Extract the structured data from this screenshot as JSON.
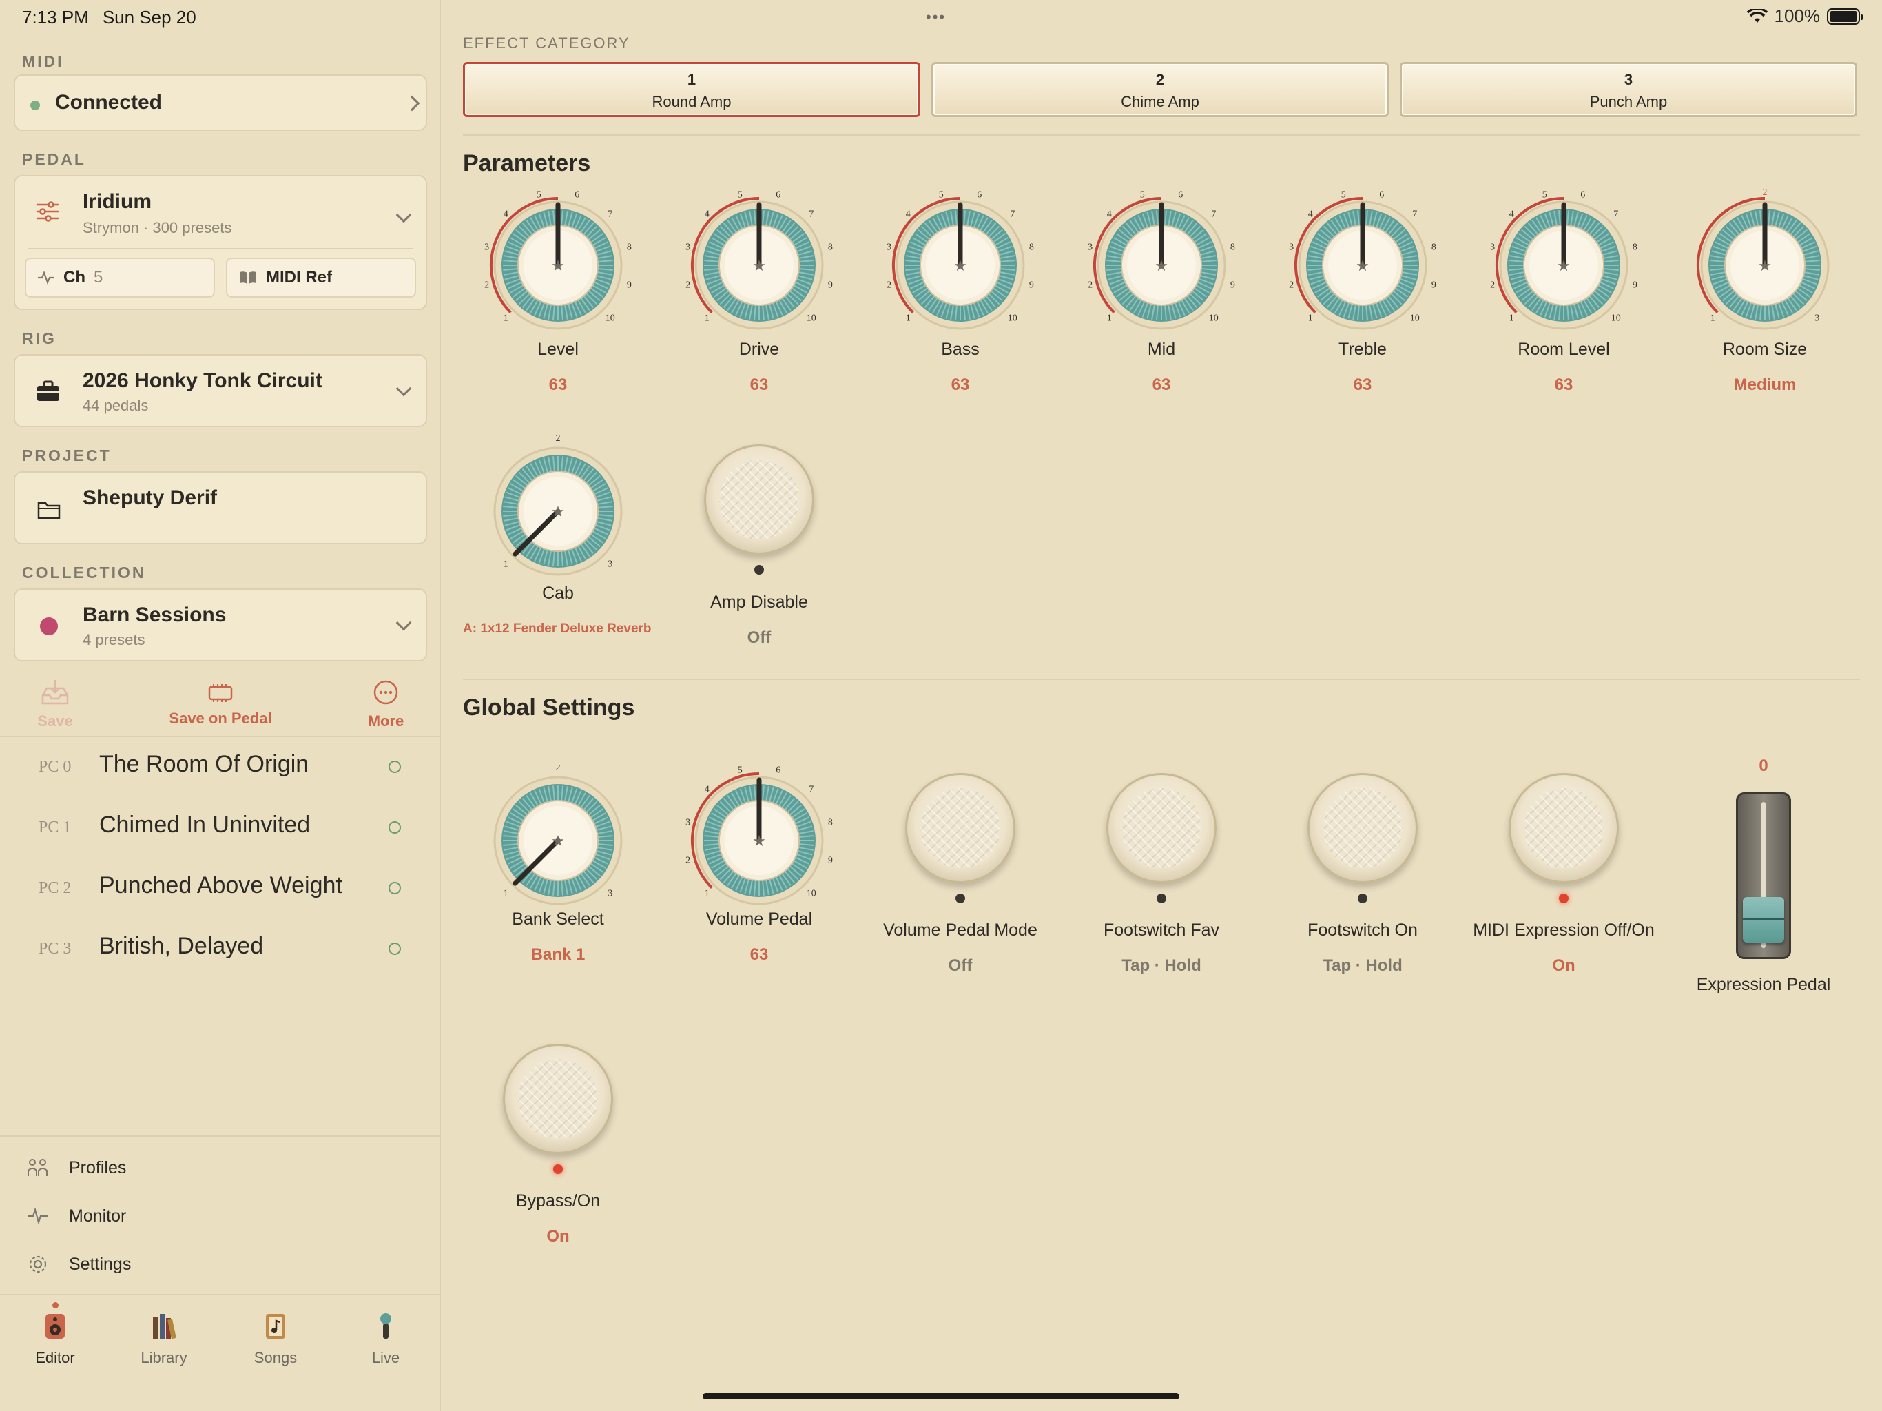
{
  "status_bar": {
    "time": "7:13 PM",
    "date": "Sun Sep 20",
    "more": "•••",
    "battery": "100%"
  },
  "sidebar": {
    "midi": {
      "label": "MIDI",
      "status": "Connected"
    },
    "pedal": {
      "label": "PEDAL",
      "name": "Iridium",
      "subtitle": "Strymon · 300 presets",
      "channel_label": "Ch",
      "channel_value": "5",
      "midi_ref": "MIDI Ref"
    },
    "rig": {
      "label": "RIG",
      "name": "2026 Honky Tonk Circuit",
      "subtitle": "44 pedals"
    },
    "project": {
      "label": "PROJECT",
      "name": "Sheputy Derif"
    },
    "collection": {
      "label": "COLLECTION",
      "name": "Barn Sessions",
      "subtitle": "4 presets"
    },
    "actions": {
      "save": "Save",
      "save_on_pedal": "Save on Pedal",
      "more": "More"
    },
    "presets": [
      {
        "pc": "PC 0",
        "name": "The Room Of Origin"
      },
      {
        "pc": "PC 1",
        "name": "Chimed In Uninvited"
      },
      {
        "pc": "PC 2",
        "name": "Punched Above Weight"
      },
      {
        "pc": "PC 3",
        "name": "British, Delayed"
      }
    ],
    "nav": {
      "profiles": "Profiles",
      "monitor": "Monitor",
      "settings": "Settings"
    },
    "tabs": {
      "editor": "Editor",
      "library": "Library",
      "songs": "Songs",
      "live": "Live"
    }
  },
  "main": {
    "effect_category_label": "EFFECT CATEGORY",
    "effects": [
      {
        "num": "1",
        "name": "Round Amp",
        "selected": true
      },
      {
        "num": "2",
        "name": "Chime Amp",
        "selected": false
      },
      {
        "num": "3",
        "name": "Punch Amp",
        "selected": false
      }
    ],
    "parameters_title": "Parameters",
    "parameters": {
      "level": {
        "name": "Level",
        "value": "63"
      },
      "drive": {
        "name": "Drive",
        "value": "63"
      },
      "bass": {
        "name": "Bass",
        "value": "63"
      },
      "mid": {
        "name": "Mid",
        "value": "63"
      },
      "treble": {
        "name": "Treble",
        "value": "63"
      },
      "room_level": {
        "name": "Room Level",
        "value": "63"
      },
      "room_size": {
        "name": "Room Size",
        "value": "Medium"
      },
      "cab": {
        "name": "Cab",
        "detail": "A: 1x12 Fender Deluxe Reverb"
      },
      "amp_disable": {
        "name": "Amp Disable",
        "value": "Off"
      }
    },
    "global_title": "Global Settings",
    "global": {
      "bank_select": {
        "name": "Bank Select",
        "value": "Bank 1"
      },
      "volume_pedal": {
        "name": "Volume Pedal",
        "value": "63"
      },
      "volume_pedal_mode": {
        "name": "Volume Pedal Mode",
        "value": "Off"
      },
      "footswitch_fav": {
        "name": "Footswitch Fav",
        "value": "Tap · Hold"
      },
      "footswitch_on": {
        "name": "Footswitch On",
        "value": "Tap · Hold"
      },
      "midi_expression": {
        "name": "MIDI Expression Off/On",
        "value": "On"
      },
      "expression_pedal": {
        "name": "Expression Pedal",
        "value": "0"
      },
      "bypass": {
        "name": "Bypass/On",
        "value": "On"
      }
    },
    "colors": {
      "accent": "#c9654b",
      "teal": "#5e9e98",
      "selected_border": "#c4463a",
      "led_on": "#e2432d"
    }
  }
}
